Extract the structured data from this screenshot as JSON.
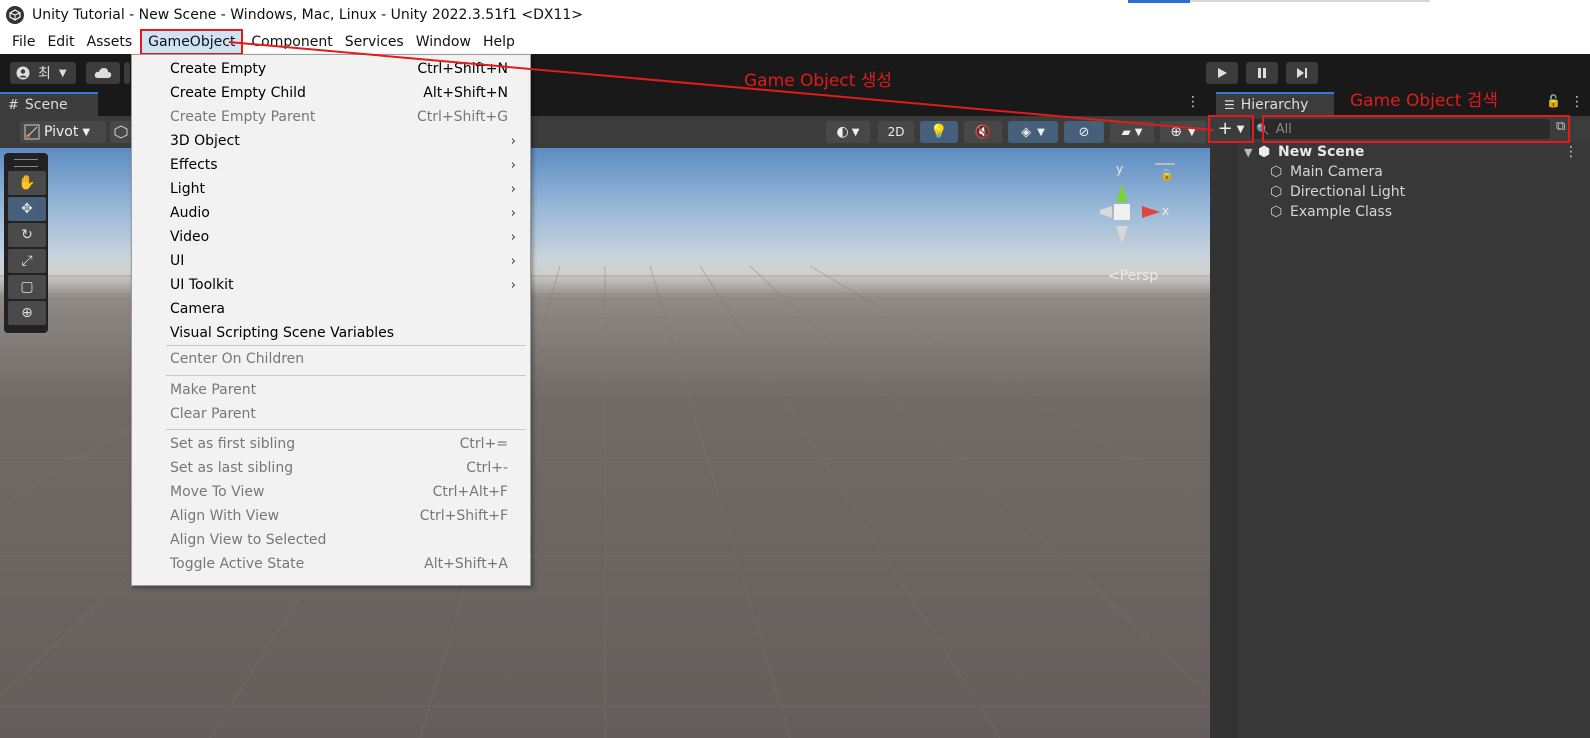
{
  "window": {
    "title": "Unity Tutorial - New Scene - Windows, Mac, Linux - Unity 2022.3.51f1 <DX11>"
  },
  "menubar": {
    "items": [
      "File",
      "Edit",
      "Assets",
      "GameObject",
      "Component",
      "Services",
      "Window",
      "Help"
    ],
    "active": "GameObject"
  },
  "toolbar": {
    "account_label": "최"
  },
  "scene": {
    "tab_label": "Scene",
    "pivot_label": "Pivot",
    "mode_2d_label": "2D",
    "persp_label": "<Persp",
    "gizmo_y": "y",
    "gizmo_x": "x"
  },
  "dropdown": {
    "items": [
      {
        "label": "Create Empty",
        "shortcut": "Ctrl+Shift+N",
        "submenu": false,
        "disabled": false
      },
      {
        "label": "Create Empty Child",
        "shortcut": "Alt+Shift+N",
        "submenu": false,
        "disabled": false
      },
      {
        "label": "Create Empty Parent",
        "shortcut": "Ctrl+Shift+G",
        "submenu": false,
        "disabled": true
      },
      {
        "label": "3D Object",
        "shortcut": "",
        "submenu": true,
        "disabled": false
      },
      {
        "label": "Effects",
        "shortcut": "",
        "submenu": true,
        "disabled": false
      },
      {
        "label": "Light",
        "shortcut": "",
        "submenu": true,
        "disabled": false
      },
      {
        "label": "Audio",
        "shortcut": "",
        "submenu": true,
        "disabled": false
      },
      {
        "label": "Video",
        "shortcut": "",
        "submenu": true,
        "disabled": false
      },
      {
        "label": "UI",
        "shortcut": "",
        "submenu": true,
        "disabled": false
      },
      {
        "label": "UI Toolkit",
        "shortcut": "",
        "submenu": true,
        "disabled": false
      },
      {
        "label": "Camera",
        "shortcut": "",
        "submenu": false,
        "disabled": false
      },
      {
        "label": "Visual Scripting Scene Variables",
        "shortcut": "",
        "submenu": false,
        "disabled": false
      },
      {
        "label": "Center On Children",
        "shortcut": "",
        "submenu": false,
        "disabled": true
      },
      {
        "label": "Make Parent",
        "shortcut": "",
        "submenu": false,
        "disabled": true
      },
      {
        "label": "Clear Parent",
        "shortcut": "",
        "submenu": false,
        "disabled": true
      },
      {
        "label": "Set as first sibling",
        "shortcut": "Ctrl+=",
        "submenu": false,
        "disabled": true
      },
      {
        "label": "Set as last sibling",
        "shortcut": "Ctrl+-",
        "submenu": false,
        "disabled": true
      },
      {
        "label": "Move To View",
        "shortcut": "Ctrl+Alt+F",
        "submenu": false,
        "disabled": true
      },
      {
        "label": "Align With View",
        "shortcut": "Ctrl+Shift+F",
        "submenu": false,
        "disabled": true
      },
      {
        "label": "Align View to Selected",
        "shortcut": "",
        "submenu": false,
        "disabled": true
      },
      {
        "label": "Toggle Active State",
        "shortcut": "Alt+Shift+A",
        "submenu": false,
        "disabled": true
      }
    ]
  },
  "hierarchy": {
    "tab_label": "Hierarchy",
    "search_placeholder": "All",
    "scene_name": "New Scene",
    "objects": [
      "Main Camera",
      "Directional Light",
      "Example Class"
    ]
  },
  "annotations": {
    "create_label": "Game Object 생성",
    "search_label": "Game Object 검색"
  },
  "colors": {
    "accent": "#e21b1b",
    "tab_highlight": "#3a79d6"
  },
  "icons": {
    "hand_tool": "hand-icon",
    "move_tool": "move-icon",
    "rotate_tool": "rotate-icon",
    "scale_tool": "scale-icon",
    "rect_tool": "rect-icon",
    "transform_tool": "transform-icon",
    "play": "play-icon",
    "pause": "pause-icon",
    "step": "step-icon"
  }
}
